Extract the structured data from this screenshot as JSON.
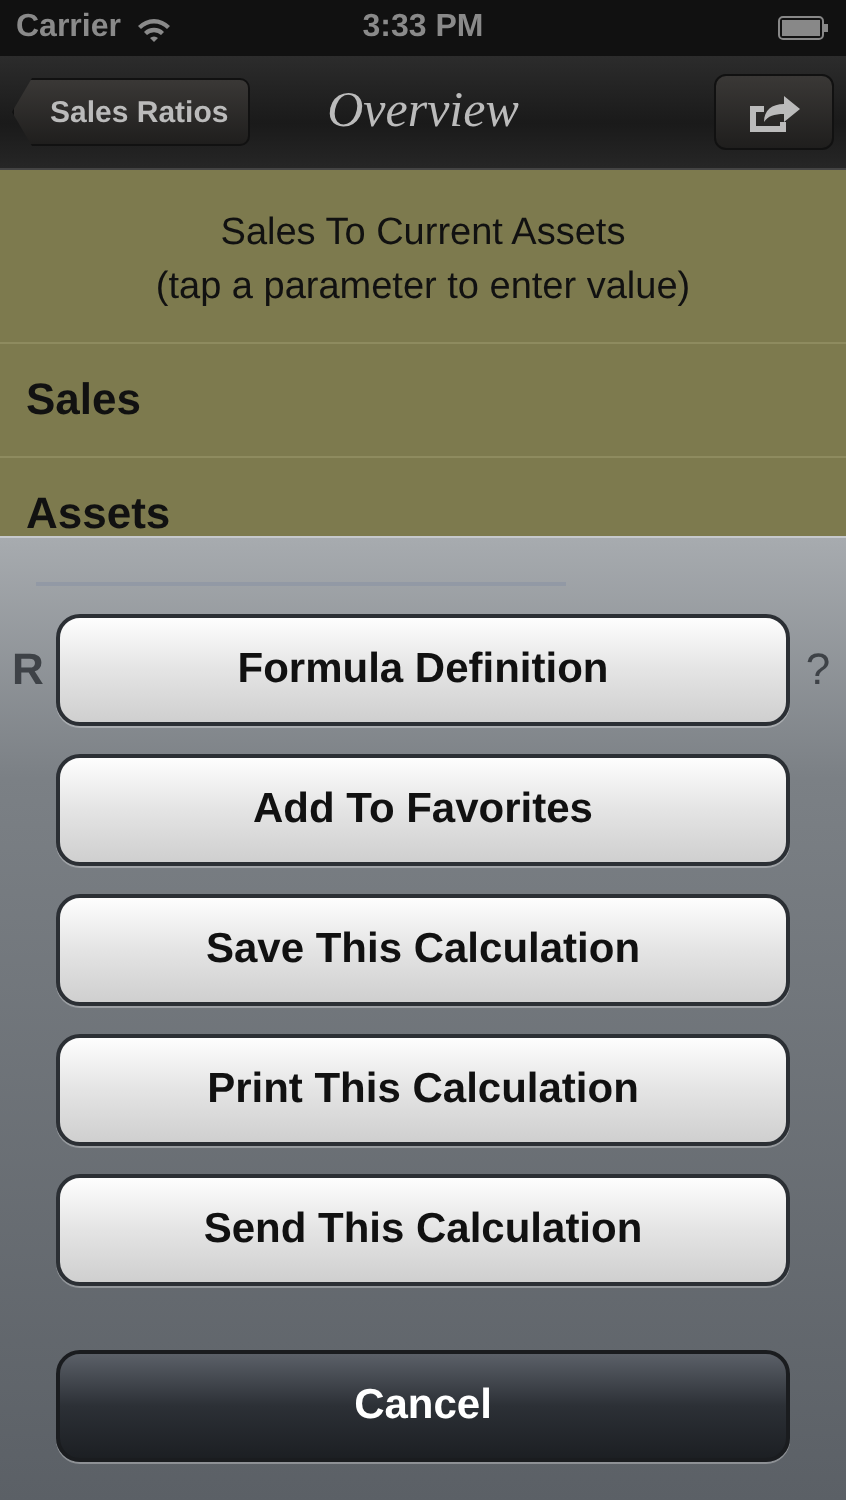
{
  "status_bar": {
    "carrier": "Carrier",
    "time": "3:33 PM"
  },
  "nav_bar": {
    "back_button": "Sales Ratios",
    "title": "Overview"
  },
  "header": {
    "title": "Sales To Current Assets",
    "hint": "(tap a parameter to enter value)"
  },
  "parameters": [
    "Sales",
    "Assets"
  ],
  "behind_sheet": {
    "left": "R",
    "right": "?"
  },
  "action_sheet": {
    "buttons": [
      {
        "label": "Formula Definition",
        "kind": "action"
      },
      {
        "label": "Add To Favorites",
        "kind": "action"
      },
      {
        "label": "Save This Calculation",
        "kind": "action"
      },
      {
        "label": "Print This Calculation",
        "kind": "action"
      },
      {
        "label": "Send This Calculation",
        "kind": "action"
      },
      {
        "label": "Cancel",
        "kind": "cancel"
      }
    ]
  }
}
